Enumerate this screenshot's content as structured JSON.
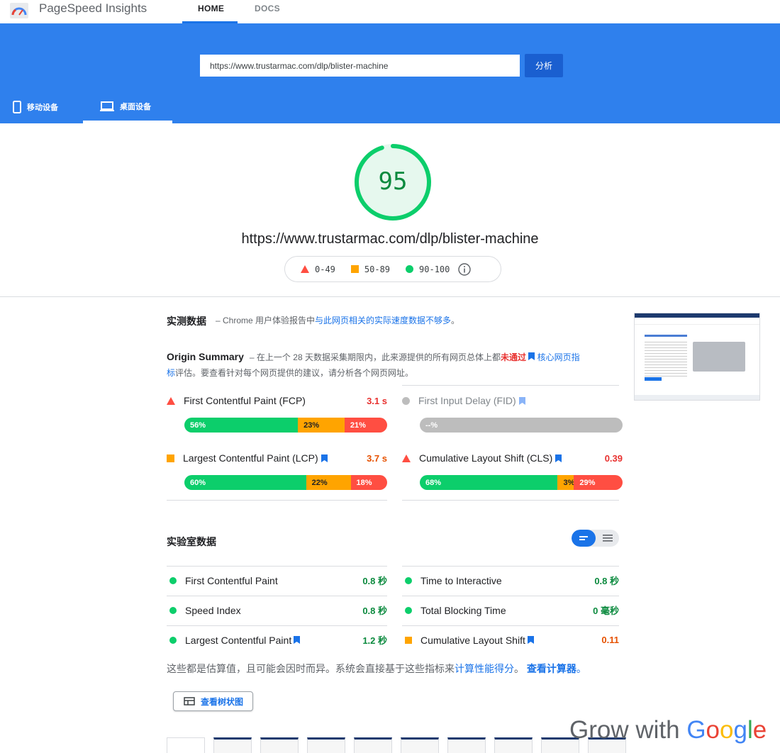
{
  "app": {
    "title": "PageSpeed Insights"
  },
  "nav": {
    "home": "HOME",
    "docs": "DOCS"
  },
  "search": {
    "url_value": "https://www.trustarmac.com/dlp/blister-machine",
    "analyze_label": "分析"
  },
  "devices": {
    "mobile": "移动设备",
    "desktop": "桌面设备"
  },
  "score": {
    "value": "95",
    "fraction": 0.95,
    "url": "https://www.trustarmac.com/dlp/blister-machine"
  },
  "legend": {
    "poor": "0-49",
    "average": "50-89",
    "good": "90-100"
  },
  "field": {
    "title": "实测数据",
    "desc_prefix": "– Chrome 用户体验报告中",
    "desc_link": "与此网页相关的实际速度数据不够多",
    "desc_suffix": "。",
    "origin_title": "Origin Summary",
    "origin_desc_1": "– 在上一个 28 天数据采集期限内，此来源提供的所有网页总体上都",
    "origin_fail": "未通过",
    "origin_link": "核心网页指标",
    "origin_desc_2": "评估。要查看针对每个网页提供的建议，请分析各个网页网址。",
    "metrics": [
      {
        "name": "First Contentful Paint (FCP)",
        "value": "3.1 s",
        "segments": [
          "56%",
          "23%",
          "21%"
        ]
      },
      {
        "name": "First Input Delay (FID)",
        "value": "",
        "segments": [
          "--%"
        ]
      },
      {
        "name": "Largest Contentful Paint (LCP)",
        "value": "3.7 s",
        "segments": [
          "60%",
          "22%",
          "18%"
        ]
      },
      {
        "name": "Cumulative Layout Shift (CLS)",
        "value": "0.39",
        "segments": [
          "68%",
          "3%",
          "29%"
        ]
      }
    ]
  },
  "lab": {
    "title": "实验室数据",
    "rows": [
      {
        "name": "First Contentful Paint",
        "value": "0.8 秒"
      },
      {
        "name": "Time to Interactive",
        "value": "0.8 秒"
      },
      {
        "name": "Speed Index",
        "value": "0.8 秒"
      },
      {
        "name": "Total Blocking Time",
        "value": "0 毫秒"
      },
      {
        "name": "Largest Contentful Paint",
        "value": "1.2 秒"
      },
      {
        "name": "Cumulative Layout Shift",
        "value": "0.11"
      }
    ],
    "note_prefix": "这些都是估算值，且可能会因时而异。系统会直接基于这些指标来",
    "note_link1": "计算性能得分",
    "note_mid": "。",
    "note_link2": "查看计算器",
    "note_end": "。",
    "treemap_label": "查看树状图"
  },
  "watermark": {
    "prefix": "Grow with ",
    "brand": "Google"
  },
  "colors": {
    "header_blue": "#2f80ed",
    "good": "#0cce6b",
    "average": "#ffa400",
    "poor": "#ff4e42"
  }
}
